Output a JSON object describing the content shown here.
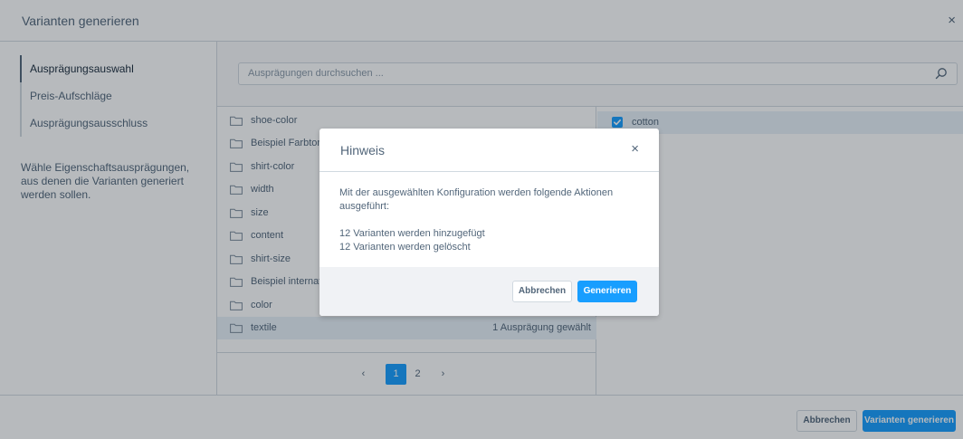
{
  "modal": {
    "title": "Varianten generieren",
    "close_glyph": "×"
  },
  "sidebar": {
    "items": [
      {
        "label": "Ausprägungsauswahl",
        "active": true
      },
      {
        "label": "Preis-Aufschläge",
        "active": false
      },
      {
        "label": "Ausprägungsausschluss",
        "active": false
      }
    ],
    "description": "Wähle Eigenschaftsausprägungen, aus denen die Varianten generiert werden sollen."
  },
  "search": {
    "placeholder": "Ausprägungen durchsuchen ...",
    "icon": "search-icon"
  },
  "groups": [
    {
      "label": "shoe-color",
      "meta": ""
    },
    {
      "label": "Beispiel Farbton",
      "meta": ""
    },
    {
      "label": "shirt-color",
      "meta": ""
    },
    {
      "label": "width",
      "meta": ""
    },
    {
      "label": "size",
      "meta": ""
    },
    {
      "label": "content",
      "meta": ""
    },
    {
      "label": "shirt-size",
      "meta": ""
    },
    {
      "label": "Beispiel internatio",
      "meta": ""
    },
    {
      "label": "color",
      "meta": ""
    },
    {
      "label": "textile",
      "meta": "1 Ausprägung gewählt",
      "selected": true
    }
  ],
  "pagination": {
    "prev": "‹",
    "pages": [
      "1",
      "2"
    ],
    "current": "1",
    "next": "›"
  },
  "options": [
    {
      "label": "cotton",
      "checked": true
    }
  ],
  "footer": {
    "cancel_label": "Abbrechen",
    "generate_label": "Varianten generieren"
  },
  "dialog": {
    "title": "Hinweis",
    "close_glyph": "×",
    "message": "Mit der ausgewählten Konfiguration werden folgende Aktionen ausgeführt:",
    "added": "12 Varianten werden hinzugefügt",
    "removed": "12 Varianten werden gelöscht",
    "cancel_label": "Abbrechen",
    "confirm_label": "Generieren"
  },
  "colors": {
    "accent": "#189eff",
    "text": "#52667a",
    "border": "#d1d9e0",
    "selected_row": "#e9f1f8"
  }
}
